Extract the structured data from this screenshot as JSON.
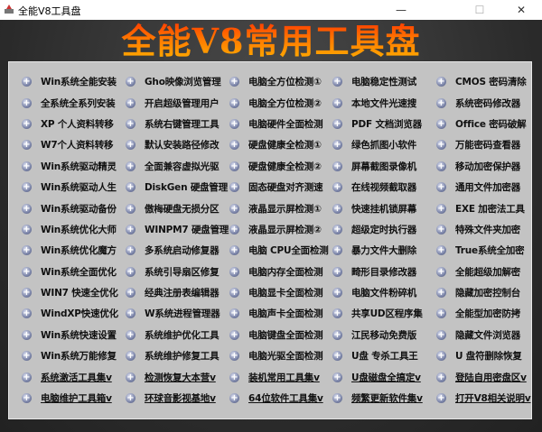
{
  "window": {
    "title": "全能V8工具盘",
    "minimize": "—",
    "maximize": "☐",
    "close": "✕"
  },
  "banner": "全能V8常用工具盘",
  "rows": [
    [
      "Win系统全能安装",
      "Gho映像浏览管理",
      "电脑全方位检测①",
      "电脑稳定性测试",
      "CMOS 密码清除"
    ],
    [
      "全系统全系列安装",
      "开启超级管理用户",
      "电脑全方位检测②",
      "本地文件光速搜",
      "系统密码修改器"
    ],
    [
      "XP 个人资料转移",
      "系统右键管理工具",
      "电脑硬件全面检测",
      "PDF 文档浏览器",
      "Office 密码破解"
    ],
    [
      "W7个人资料转移",
      "默认安装路径修改",
      "硬盘健康全检测①",
      "绿色抓图小软件",
      "万能密码查看器"
    ],
    [
      "Win系统驱动精灵",
      "全面兼容虚拟光驱",
      "硬盘健康全检测②",
      "屏幕截图录像机",
      "移动加密保护器"
    ],
    [
      "Win系统驱动人生",
      "DiskGen 硬盘管理",
      "固态硬盘对齐测速",
      "在线视频截取器",
      "通用文件加密器"
    ],
    [
      "Win系统驱动备份",
      "傲梅硬盘无损分区",
      "液晶显示屏检测①",
      "快速挂机锁屏幕",
      "EXE 加密法工具"
    ],
    [
      "Win系统优化大师",
      "WINPM7 硬盘管理",
      "液晶显示屏检测②",
      "超级定时执行器",
      "特殊文件夹加密"
    ],
    [
      "Win系统优化魔方",
      "多系统启动修复器",
      "电脑 CPU全面检测",
      "暴力文件大删除",
      "True系统全加密"
    ],
    [
      "Win系统全面优化",
      "系统引导扇区修复",
      "电脑内存全面检测",
      "畸形目录修改器",
      "全能超级加解密"
    ],
    [
      "WIN7 快速全优化",
      "经典注册表编辑器",
      "电脑显卡全面检测",
      "电脑文件粉碎机",
      "隐藏加密控制台"
    ],
    [
      "WindXP快速优化",
      "W系统进程管理器",
      "电脑声卡全面检测",
      "共享UD区程序集",
      "全能型加密防拷"
    ],
    [
      "Win系统快速设置",
      "系统维护优化工具",
      "电脑键盘全面检测",
      "江民移动免费版",
      "隐藏文件浏览器"
    ],
    [
      "Win系统万能修复",
      "系统维护修复工具",
      "电脑光驱全面检测",
      "U盘 专杀工具王",
      "U 盘符删除恢复"
    ],
    [
      "系统激活工具集v",
      "检测恢复大本营v",
      "装机常用工具集v",
      "U盘磁盘全搞定v",
      "登陆自用密盘区v"
    ],
    [
      "电脑维护工具箱v",
      "环球音影视基地v",
      "64位软件工具集v",
      "频繁更新软件集v",
      "打开V8相关说明v"
    ]
  ],
  "link_rows": [
    14,
    15
  ],
  "icon": "plus-circle-icon"
}
